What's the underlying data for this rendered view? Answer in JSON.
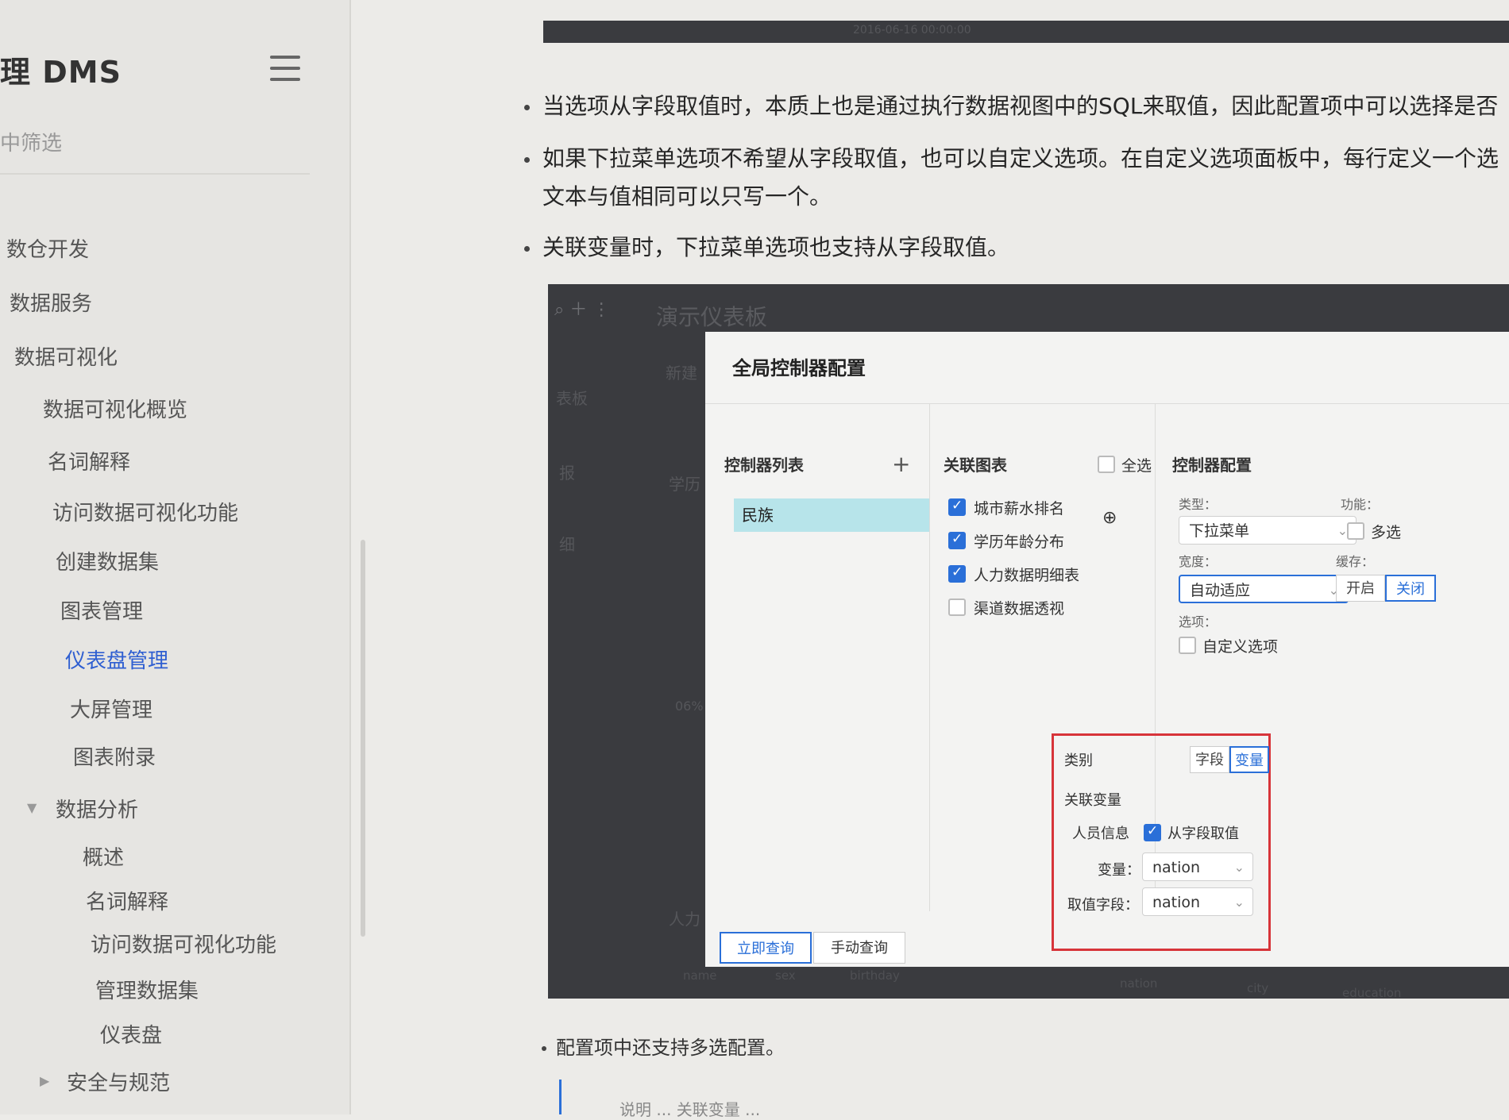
{
  "sidebar": {
    "brand": "理 DMS",
    "filter_label": "中筛选",
    "items": [
      {
        "label": "数仓开发"
      },
      {
        "label": "数据服务"
      },
      {
        "label": "数据可视化"
      },
      {
        "label": "数据可视化概览"
      },
      {
        "label": "名词解释"
      },
      {
        "label": "访问数据可视化功能"
      },
      {
        "label": "创建数据集"
      },
      {
        "label": "图表管理"
      },
      {
        "label": "仪表盘管理",
        "active": true
      },
      {
        "label": "大屏管理"
      },
      {
        "label": "图表附录"
      },
      {
        "label": "数据分析"
      },
      {
        "label": "概述"
      },
      {
        "label": "名词解释"
      },
      {
        "label": "访问数据可视化功能"
      },
      {
        "label": "管理数据集"
      },
      {
        "label": "仪表盘"
      },
      {
        "label": "安全与规范"
      }
    ]
  },
  "doc": {
    "topbar_ghost": [
      "2016-06-16 00:00:00"
    ],
    "bullets": [
      "当选项从字段取值时，本质上也是通过执行数据视图中的SQL来取值，因此配置项中可以选择是否",
      "如果下拉菜单选项不希望从字段取值，也可以自定义选项。在自定义选项面板中，每行定义一个选",
      "文本与值相同可以只写一个。",
      "关联变量时，下拉菜单选项也支持从字段取值。"
    ],
    "bottom_bullet": "配置项中还支持多选配置。",
    "bottom_ghost": "说明 ... 关联变量 ..."
  },
  "screenshot": {
    "dashboard_title": "演示仪表板",
    "left_labels": [
      "表板",
      "报",
      "细"
    ],
    "ghost_labels": [
      "新建",
      "学历",
      "人力",
      "06%"
    ],
    "ghost_columns": [
      "name",
      "sex",
      "birthday",
      "nation",
      "city",
      "education"
    ],
    "modal": {
      "title": "全局控制器配置",
      "controller_list_head": "控制器列表",
      "add_symbol": "+",
      "controller_item": "民族",
      "related_charts_head": "关联图表",
      "select_all": "全选",
      "charts": [
        {
          "label": "城市薪水排名",
          "checked": true
        },
        {
          "label": "学历年龄分布",
          "checked": true
        },
        {
          "label": "人力数据明细表",
          "checked": true
        },
        {
          "label": "渠道数据透视",
          "checked": false
        }
      ],
      "config_head": "控制器配置",
      "type_label": "类型：",
      "type_value": "下拉菜单",
      "function_label": "功能：",
      "multi_select": "多选",
      "width_label": "宽度：",
      "width_value": "自动适应",
      "cache_label": "缓存：",
      "cache_on": "开启",
      "cache_off": "关闭",
      "options_label": "选项：",
      "custom_options": "自定义选项",
      "category_label": "类别",
      "category_field": "字段",
      "category_variable": "变量",
      "related_variable_label": "关联变量",
      "person_info": "人员信息",
      "from_field": "从字段取值",
      "variable_label": "变量：",
      "variable_value": "nation",
      "value_field_label": "取值字段：",
      "value_field_value": "nation",
      "btn_instant": "立即查询",
      "btn_manual": "手动查询"
    }
  },
  "colors": {
    "accent": "#2a6fd8",
    "highlight": "#d7343a",
    "selected_row": "#b7e4ea"
  }
}
